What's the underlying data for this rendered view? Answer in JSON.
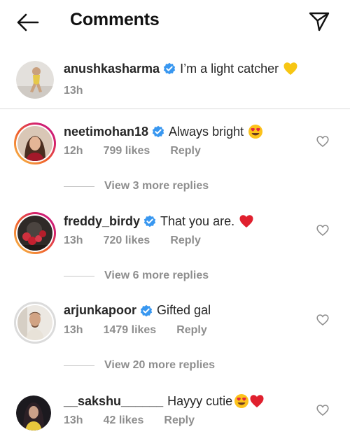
{
  "header": {
    "title": "Comments"
  },
  "caption": {
    "username": "anushkasharma",
    "text": "I’m a light catcher",
    "time": "13h",
    "emoji": "yellow-heart"
  },
  "comments": [
    {
      "username": "neetimohan18",
      "text": "Always bright",
      "emoji": "heart-eyes",
      "time": "12h",
      "likes": "799 likes",
      "reply": "Reply",
      "view_replies": "View 3 more replies"
    },
    {
      "username": "freddy_birdy",
      "text": "That you are.",
      "emoji": "red-heart",
      "time": "13h",
      "likes": "720 likes",
      "reply": "Reply",
      "view_replies": "View 6 more replies"
    },
    {
      "username": "arjunkapoor",
      "text": "Gifted gal",
      "emoji": "",
      "time": "13h",
      "likes": "1479 likes",
      "reply": "Reply",
      "view_replies": "View 20 more replies"
    },
    {
      "username": "__sakshu______",
      "text": "Hayyy cutie",
      "emoji": "heart-eyes red-heart",
      "time": "13h",
      "likes": "42 likes",
      "reply": "Reply"
    }
  ],
  "colors": {
    "verified": "#3897f0",
    "muted": "#8e8e8e",
    "text": "#262626"
  }
}
